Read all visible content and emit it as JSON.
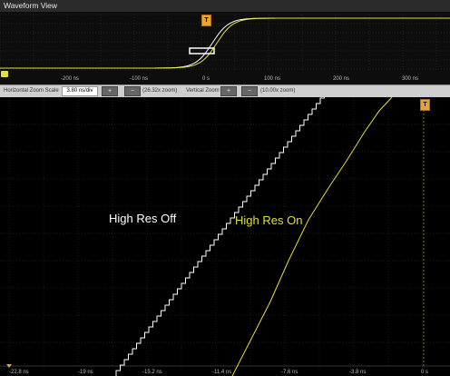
{
  "window": {
    "title": "Waveform View"
  },
  "overview": {
    "time_ticks": [
      "-200 ns",
      "-100 ns",
      "0 s",
      "100 ns",
      "200 ns",
      "300 ns"
    ],
    "trigger_label": "T"
  },
  "controls": {
    "h_zoom_label": "Horizontal Zoom Scale",
    "h_zoom_value": "3.80 ns/div",
    "h_zoom_factor": "(26.32x zoom)",
    "v_zoom_label": "Vertical Zoom",
    "v_zoom_value": "(10.00x zoom)",
    "plus_label": "+",
    "minus_label": "−"
  },
  "zoomed": {
    "time_ticks": [
      "-22.8 ns",
      "-19 ns",
      "-15.2 ns",
      "-11.4 ns",
      "-7.6 ns",
      "-3.8 ns",
      "0 s"
    ],
    "trigger_label": "T",
    "annotations": {
      "off": "High Res Off",
      "on": "High Res On"
    }
  },
  "colors": {
    "trace_off": "#ffffff",
    "trace_on": "#e5dd3c",
    "trigger": "#e8a23a",
    "grid": "#3a3a3a"
  },
  "icons": {
    "trigger": "trigger-t-icon",
    "channel": "channel-marker-icon"
  }
}
